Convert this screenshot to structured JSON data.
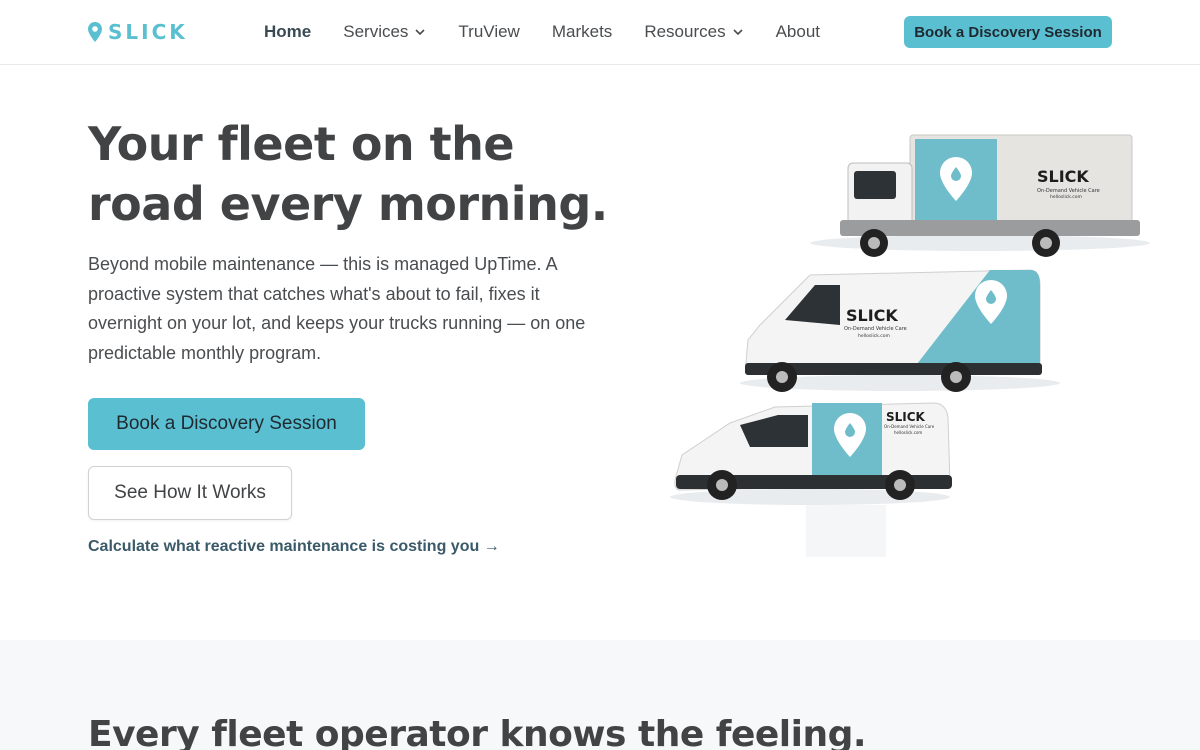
{
  "header": {
    "logo_text": "SLICK",
    "nav": [
      {
        "label": "Home",
        "active": true,
        "dropdown": false
      },
      {
        "label": "Services",
        "active": false,
        "dropdown": true
      },
      {
        "label": "TruView",
        "active": false,
        "dropdown": false
      },
      {
        "label": "Markets",
        "active": false,
        "dropdown": false
      },
      {
        "label": "Resources",
        "active": false,
        "dropdown": true
      },
      {
        "label": "About",
        "active": false,
        "dropdown": false
      }
    ],
    "cta_label": "Book a Discovery Session"
  },
  "hero": {
    "title_line1": "Your fleet on the",
    "title_line2": "road every morning.",
    "subtitle": "Beyond mobile maintenance — this is managed UpTime. A proactive system that catches what's about to fail, fixes it overnight on your lot, and keeps your trucks running — on one predictable monthly program.",
    "primary_cta": "Book a Discovery Session",
    "secondary_cta": "See How It Works",
    "calc_link": "Calculate what reactive maintenance is costing you →"
  },
  "illustration": {
    "truck_brand": "SLICK",
    "truck_tagline": "On-Demand Vehicle Care",
    "truck_url": "helloslick.com"
  },
  "section2": {
    "title": "Every fleet operator knows the feeling."
  },
  "colors": {
    "brand": "#5bbfd2",
    "text": "#414345",
    "band_bg": "#f7f8f9"
  }
}
